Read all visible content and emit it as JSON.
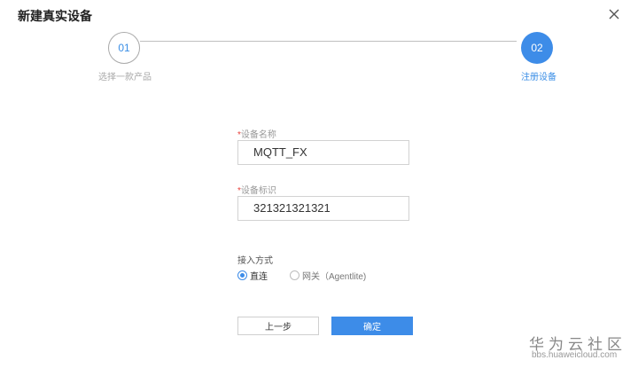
{
  "dialog": {
    "title": "新建真实设备"
  },
  "steps": [
    {
      "number": "01",
      "label": "选择一款产品",
      "state": "done"
    },
    {
      "number": "02",
      "label": "注册设备",
      "state": "active"
    }
  ],
  "form": {
    "required_mark": "*",
    "device_name": {
      "label": "设备名称",
      "value": "MQTT_FX"
    },
    "device_id": {
      "label": "设备标识",
      "value": "321321321321"
    },
    "access": {
      "label": "接入方式",
      "options": [
        {
          "label": "直连",
          "selected": true
        },
        {
          "label": "网关（Agentlite)",
          "selected": false
        }
      ]
    }
  },
  "buttons": {
    "prev": "上一步",
    "confirm": "确定"
  },
  "watermark": {
    "main": "华为云社区",
    "sub": "bbs.huaweicloud.com"
  },
  "colors": {
    "primary": "#3d8ce8",
    "required": "#e8423c"
  },
  "icons": {
    "close": "close-icon"
  }
}
